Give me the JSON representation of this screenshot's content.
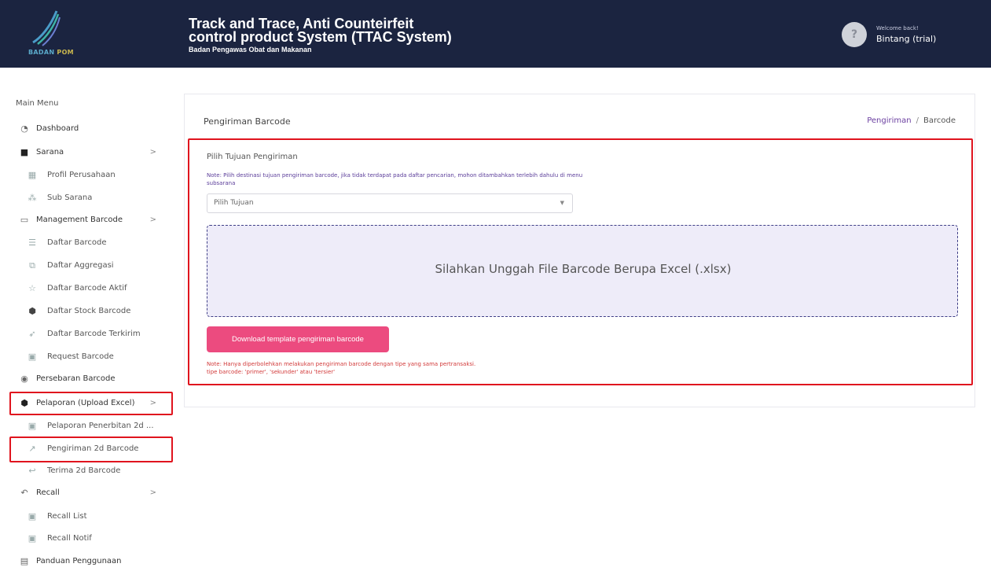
{
  "header": {
    "logo_text_1": "BADAN",
    "logo_text_2": "POM",
    "title_line1": "Track and Trace, Anti Counteirfeit",
    "title_line2": "control product System (TTAC System)",
    "subtitle": "Badan Pengawas Obat dan Makanan",
    "welcome": "Welcome back!",
    "username": "Bintang (trial)",
    "avatar_glyph": "?"
  },
  "sidebar": {
    "heading": "Main Menu",
    "chevron": ">",
    "items": [
      {
        "label": "Dashboard",
        "icon": "dashboard-icon"
      },
      {
        "label": "Sarana",
        "icon": "sarana-icon"
      },
      {
        "label": "Profil Perusahaan",
        "icon": "building-icon"
      },
      {
        "label": "Sub Sarana",
        "icon": "sub-sarana-icon"
      },
      {
        "label": "Management Barcode",
        "icon": "window-icon"
      },
      {
        "label": "Daftar Barcode",
        "icon": "list-icon"
      },
      {
        "label": "Daftar Aggregasi",
        "icon": "layers-icon"
      },
      {
        "label": "Daftar Barcode Aktif",
        "icon": "star-icon"
      },
      {
        "label": "Daftar Stock Barcode",
        "icon": "box-icon"
      },
      {
        "label": "Daftar Barcode Terkirim",
        "icon": "send-icon"
      },
      {
        "label": "Request Barcode",
        "icon": "monitor-icon"
      },
      {
        "label": "Persebaran Barcode",
        "icon": "location-pin-icon"
      },
      {
        "label": "Pelaporan (Upload Excel)",
        "icon": "box-icon"
      },
      {
        "label": "Pelaporan Penerbitan 2d ...",
        "icon": "monitor-icon"
      },
      {
        "label": "Pengiriman 2d Barcode",
        "icon": "share-icon"
      },
      {
        "label": "Terima 2d Barcode",
        "icon": "receive-icon"
      },
      {
        "label": "Recall",
        "icon": "recall-icon"
      },
      {
        "label": "Recall List",
        "icon": "monitor-icon"
      },
      {
        "label": "Recall Notif",
        "icon": "monitor-icon"
      },
      {
        "label": "Panduan Penggunaan",
        "icon": "calendar-icon"
      }
    ]
  },
  "main": {
    "page_title": "Pengiriman Barcode",
    "breadcrumb": {
      "link": "Pengiriman",
      "separator": "/",
      "current": "Barcode"
    },
    "form": {
      "label": "Pilih Tujuan Pengiriman",
      "note": "Note: Pilih destinasi tujuan pengiriman barcode, jika tidak terdapat pada daftar pencarian, mohon ditambahkan terlebih dahulu di menu subsarana",
      "select_placeholder": "Pilih Tujuan",
      "dropzone_text": "Silahkan Unggah File Barcode Berupa Excel (.xlsx)",
      "download_button": "Download template pengiriman barcode",
      "note_red_line1": "Note: Hanya diperbolehkan melakukan pengiriman barcode dengan tipe yang sama pertransaksi.",
      "note_red_line2": "tipe barcode: 'primer', 'sekunder' atau 'tersier'"
    }
  },
  "colors": {
    "topbar": "#1b2440",
    "highlight": "#e0141e",
    "accent_purple": "#5b3d9a",
    "button_pink": "#ec4b7f",
    "dropzone_bg": "#eeecf9"
  }
}
